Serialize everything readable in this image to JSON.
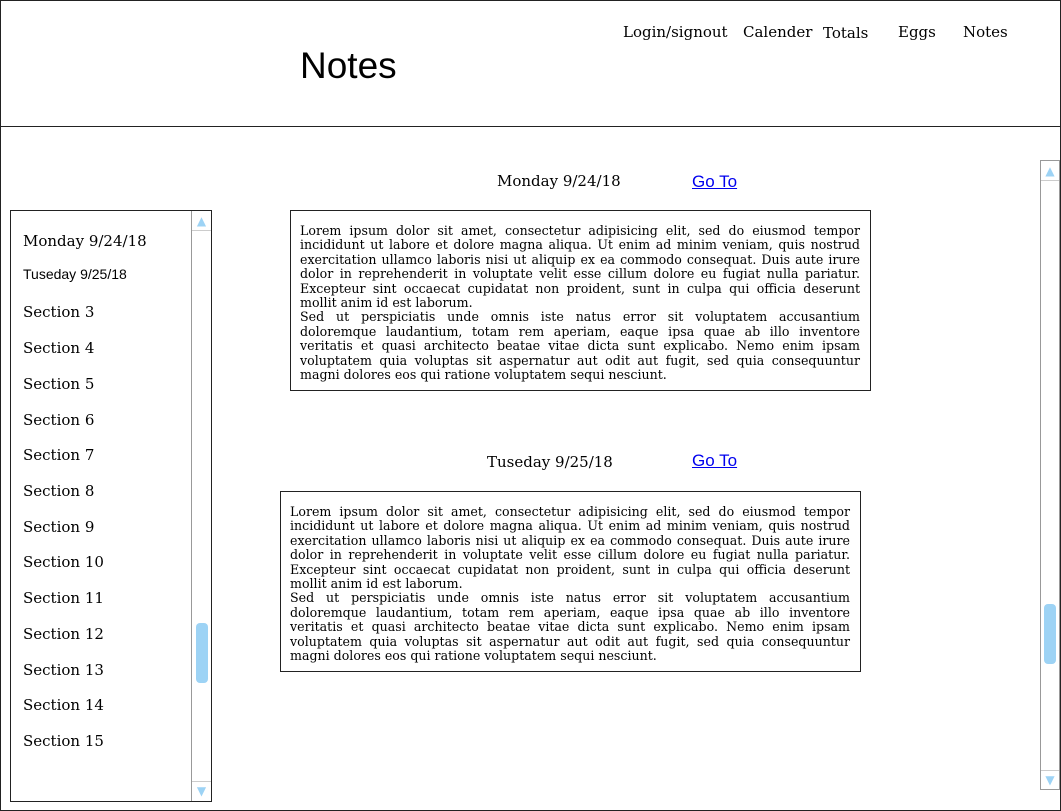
{
  "header": {
    "title": "Notes",
    "nav": [
      "Login/signout",
      "Calender",
      "Totals",
      "Eggs",
      "Notes"
    ]
  },
  "sidebar": {
    "items": [
      "Monday 9/24/18",
      "Tuseday 9/25/18",
      "Section 3",
      "Section 4",
      "Section 5",
      "Section 6",
      "Section 7",
      "Section 8",
      "Section 9",
      "Section 10",
      "Section 11",
      "Section 12",
      "Section 13",
      "Section 14",
      "Section 15"
    ]
  },
  "notes": [
    {
      "date": "Monday 9/24/18",
      "link": "Go To",
      "p1": "Lorem ipsum dolor sit amet, consectetur adipisicing elit, sed do eiusmod tempor incididunt ut labore et dolore magna aliqua. Ut enim ad minim veniam, quis nostrud exercitation ullamco laboris nisi ut aliquip ex ea commodo consequat. Duis aute irure dolor in reprehenderit in voluptate velit esse cillum dolore eu fugiat nulla pariatur. Excepteur sint occaecat cupidatat non proident, sunt in culpa qui officia deserunt mollit anim id est laborum.",
      "p2": "Sed ut perspiciatis unde omnis iste natus error sit voluptatem accusantium doloremque laudantium, totam rem aperiam, eaque ipsa quae ab illo inventore veritatis et quasi architecto beatae vitae dicta sunt explicabo. Nemo enim ipsam voluptatem quia voluptas sit aspernatur aut odit aut fugit, sed quia consequuntur magni dolores eos qui ratione voluptatem sequi nesciunt."
    },
    {
      "date": "Tuseday 9/25/18",
      "link": "Go To",
      "p1": "Lorem ipsum dolor sit amet, consectetur adipisicing elit, sed do eiusmod tempor incididunt ut labore et dolore magna aliqua. Ut enim ad minim veniam, quis nostrud exercitation ullamco laboris nisi ut aliquip ex ea commodo consequat. Duis aute irure dolor in reprehenderit in voluptate velit esse cillum dolore eu fugiat nulla pariatur. Excepteur sint occaecat cupidatat non proident, sunt in culpa qui officia deserunt mollit anim id est laborum.",
      "p2": "Sed ut perspiciatis unde omnis iste natus error sit voluptatem accusantium doloremque laudantium, totam rem aperiam, eaque ipsa quae ab illo inventore veritatis et quasi architecto beatae vitae dicta sunt explicabo. Nemo enim ipsam voluptatem quia voluptas sit aspernatur aut odit aut fugit, sed quia consequuntur magni dolores eos qui ratione voluptatem sequi nesciunt."
    }
  ],
  "icons": {
    "scroll_up": "scroll-up-arrow-icon",
    "scroll_down": "scroll-down-arrow-icon"
  },
  "colors": {
    "scrollbar_accent": "#9dd3f5",
    "link": "#0000ee"
  }
}
